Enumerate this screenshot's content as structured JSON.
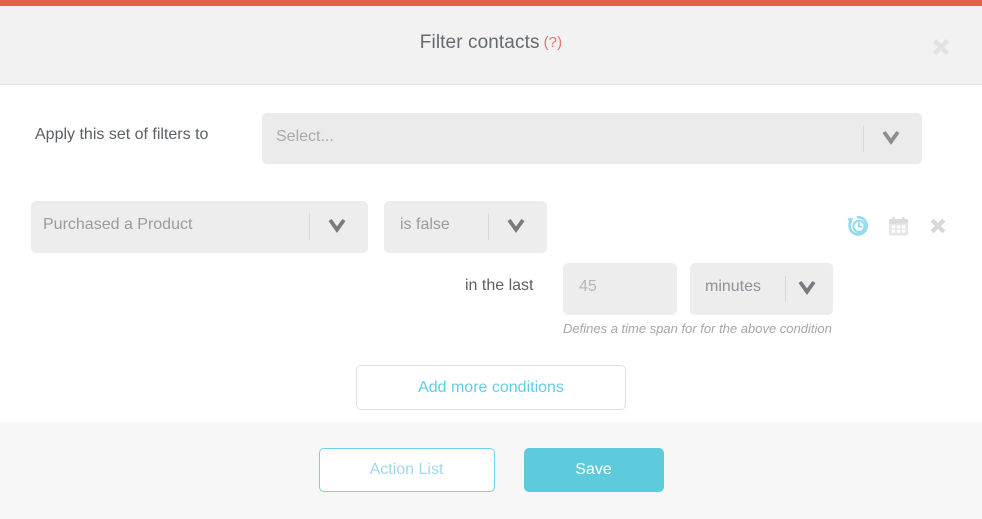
{
  "theme": {
    "accent_bar": "#e2614f",
    "primary": "#5ecbdd",
    "link": "#5ecfe4",
    "help_marker": "#e8736a"
  },
  "header": {
    "title": "Filter contacts",
    "help_marker": "(?)",
    "close_icon": "close-icon"
  },
  "body": {
    "apply_row": {
      "label": "Apply this set of filters to",
      "select_placeholder": "Select...",
      "chevron_icon": "chevron-down-icon"
    },
    "condition": {
      "field_value": "Purchased a Product",
      "operator_value": "is false",
      "actions": [
        {
          "name": "time-span-icon",
          "label": "Add time span"
        },
        {
          "name": "calendar-icon",
          "label": "Pick date"
        },
        {
          "name": "remove-condition-icon",
          "label": "Remove condition"
        }
      ]
    },
    "time_span": {
      "label": "in the last",
      "amount_placeholder": "45",
      "unit_value": "minutes",
      "help_text": "Defines a time span for for the above condition"
    },
    "add_more_label": "Add more conditions"
  },
  "footer": {
    "action_list_label": "Action List",
    "save_label": "Save"
  }
}
